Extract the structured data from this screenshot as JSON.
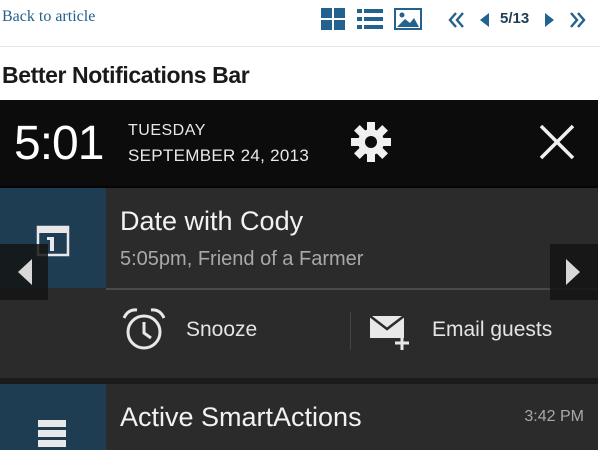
{
  "nav": {
    "back_label": "Back to article",
    "page_counter": "5/13",
    "icons": [
      "grid-view-icon",
      "list-view-icon",
      "gallery-view-icon",
      "first-page-icon",
      "prev-page-icon",
      "next-page-icon",
      "last-page-icon"
    ],
    "accent_color": "#23618e"
  },
  "page_title": "Better Notifications Bar",
  "screen": {
    "clock": "5:01",
    "day": "TUESDAY",
    "date": "SEPTEMBER 24, 2013",
    "notifications": [
      {
        "title": "Date with Cody",
        "subtitle": "5:05pm, Friend of a Farmer",
        "icon": "calendar-icon",
        "actions": [
          {
            "label": "Snooze",
            "icon": "alarm-clock-icon"
          },
          {
            "label": "Email guests",
            "icon": "email-add-icon"
          }
        ]
      },
      {
        "title": "Active SmartActions",
        "time": "3:42 PM",
        "icon": "list-stack-icon"
      }
    ],
    "header_bg": "#0c0c0c",
    "card_bg": "#2b2b2b",
    "icon_bg": "#1f3d52"
  }
}
